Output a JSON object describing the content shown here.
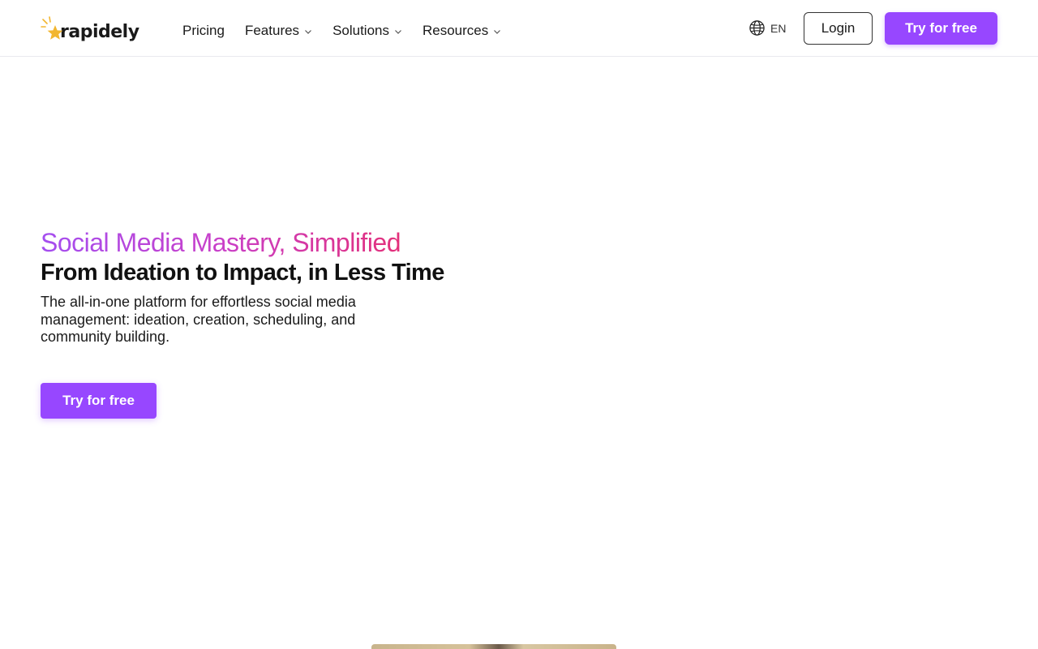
{
  "brand": {
    "name": "rapidely",
    "accent": "#9747ff",
    "logo_star_color": "#f2b630"
  },
  "nav": {
    "items": [
      {
        "label": "Pricing",
        "has_dropdown": false
      },
      {
        "label": "Features",
        "has_dropdown": true
      },
      {
        "label": "Solutions",
        "has_dropdown": true
      },
      {
        "label": "Resources",
        "has_dropdown": true
      }
    ],
    "language": "EN",
    "login_label": "Login",
    "cta_label": "Try for free"
  },
  "hero": {
    "title": "Social Media Mastery, Simplified",
    "subtitle": "From Ideation to Impact, in Less Time",
    "description": "The all-in-one platform for effortless social media management: ideation, creation, scheduling, and community building.",
    "cta_label": "Try for free"
  },
  "icons": {
    "language": "globe-icon",
    "dropdown": "chevron-down-icon"
  }
}
